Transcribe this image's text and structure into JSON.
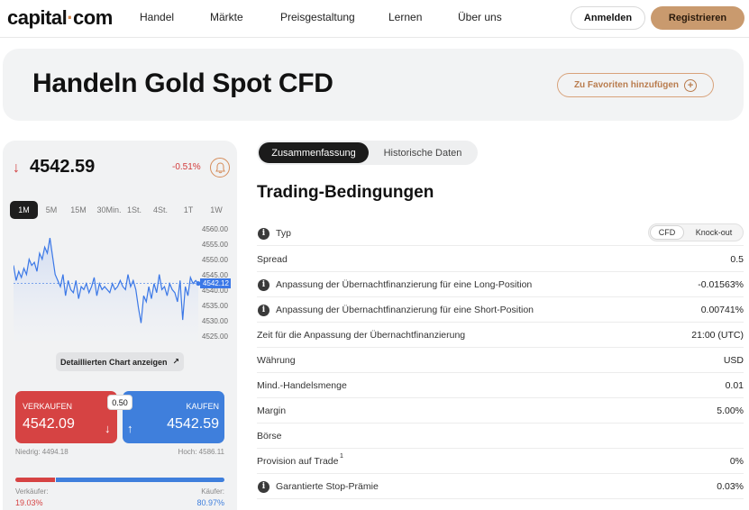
{
  "header": {
    "logo_main": "capital",
    "logo_dot": "·",
    "logo_end": "com",
    "nav": [
      "Handel",
      "Märkte",
      "Preisgestaltung",
      "Lernen",
      "Über uns"
    ],
    "login": "Anmelden",
    "register": "Registrieren"
  },
  "hero": {
    "title": "Handeln Gold Spot CFD",
    "favorite": "Zu Favoriten hinzufügen"
  },
  "quote": {
    "price": "4542.59",
    "change": "-0.51%",
    "arrow": "↓",
    "timeframes": [
      "1M",
      "5M",
      "15M",
      "30Min.",
      "1St.",
      "4St.",
      "1T",
      "1W"
    ],
    "active_timeframe": "1M",
    "chart_button": "Detaillierten Chart anzeigen",
    "sell_label": "VERKAUFEN",
    "sell_price": "4542.09",
    "buy_label": "KAUFEN",
    "buy_price": "4542.59",
    "spread": "0.50",
    "low": "Niedrig: 4494.18",
    "high": "Hoch: 4586.11",
    "sellers_label": "Verkäufer:",
    "sellers_pct": "19.03%",
    "buyers_label": "Käufer:",
    "buyers_pct": "80.97%",
    "sentiment_sell": 19.03,
    "colors": {
      "down": "#d64343",
      "up": "#3f7fdc",
      "accent": "#c99a6e"
    }
  },
  "chart_data": {
    "type": "area",
    "y_ticks": [
      "4560.00",
      "4555.00",
      "4550.00",
      "4545.00",
      "4540.00",
      "4535.00",
      "4530.00",
      "4525.00"
    ],
    "ylim": [
      4525,
      4560
    ],
    "last_value_label": "4542.12",
    "values": [
      4548,
      4543,
      4546,
      4544,
      4547,
      4545,
      4550,
      4548,
      4549,
      4546,
      4552,
      4550,
      4554,
      4552,
      4557,
      4551,
      4545,
      4543,
      4541,
      4545,
      4538,
      4543,
      4540,
      4539,
      4543,
      4537,
      4541,
      4540,
      4542,
      4539,
      4541,
      4544,
      4538,
      4542,
      4540,
      4541,
      4540,
      4539,
      4542,
      4540,
      4541,
      4543,
      4541,
      4540,
      4545,
      4541,
      4543,
      4540,
      4534,
      4529,
      4538,
      4536,
      4541,
      4537,
      4542,
      4539,
      4545,
      4540,
      4541,
      4538,
      4542,
      4540,
      4539,
      4536,
      4543,
      4530,
      4541,
      4538,
      4544,
      4542,
      4543,
      4542
    ]
  },
  "tabs": [
    "Zusammenfassung",
    "Historische Daten"
  ],
  "conditions": {
    "title": "Trading-Bedingungen",
    "type_label": "Typ",
    "type_options": [
      "CFD",
      "Knock-out"
    ],
    "rows": [
      {
        "label": "Spread",
        "value": "0.5",
        "icon": false
      },
      {
        "label": "Anpassung der Übernachtfinanzierung für eine Long-Position",
        "value": "-0.01563%",
        "icon": true
      },
      {
        "label": "Anpassung der Übernachtfinanzierung für eine Short-Position",
        "value": "0.00741%",
        "icon": true
      },
      {
        "label": "Zeit für die Anpassung der Übernachtfinanzierung",
        "value": "21:00 (UTC)",
        "icon": false
      },
      {
        "label": "Währung",
        "value": "USD",
        "icon": false
      },
      {
        "label": "Mind.-Handelsmenge",
        "value": "0.01",
        "icon": false
      },
      {
        "label": "Margin",
        "value": "5.00%",
        "icon": false
      },
      {
        "label": "Börse",
        "value": "",
        "icon": false
      },
      {
        "label": "Provision auf Trade",
        "sup": "1",
        "value": "0%",
        "icon": false
      },
      {
        "label": "Garantierte Stop-Prämie",
        "value": "0.03%",
        "icon": true
      }
    ]
  }
}
